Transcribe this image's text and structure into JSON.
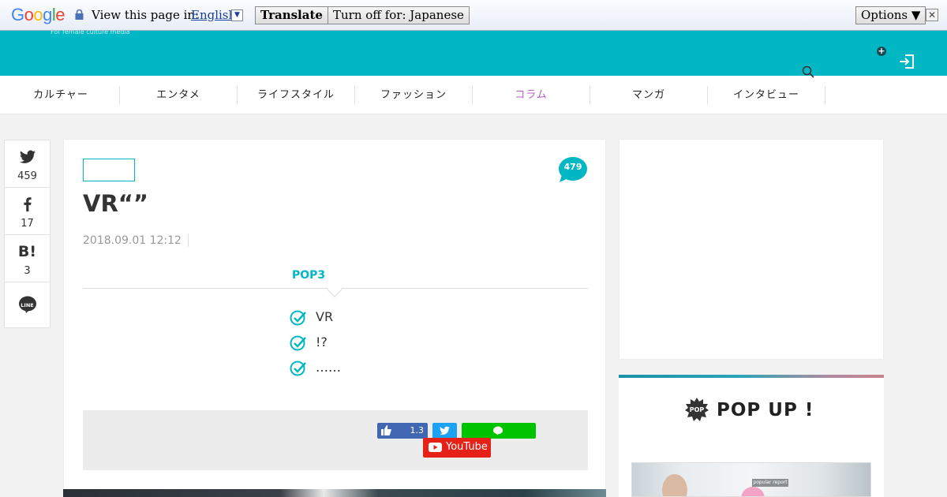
{
  "translate_bar": {
    "logo": "Google",
    "view_label": "View this page in:",
    "language": "English",
    "translate_button": "Translate",
    "turn_off_button": "Turn off for: Japanese",
    "options_button": "Options ▼",
    "close_glyph": "✕"
  },
  "header": {
    "tagline": "For female culture media"
  },
  "nav": {
    "items": [
      {
        "label": "カルチャー"
      },
      {
        "label": "エンタメ"
      },
      {
        "label": "ライフスタイル"
      },
      {
        "label": "ファッション"
      },
      {
        "label": "コラム"
      },
      {
        "label": "マンガ"
      },
      {
        "label": "インタビュー"
      }
    ],
    "active_index": 4
  },
  "share": {
    "twitter_count": "459",
    "facebook_count": "17",
    "hatena_label": "B!",
    "hatena_count": "3",
    "line_label": "LINE"
  },
  "article": {
    "comment_count": "479",
    "title": "VR“”",
    "date": "2018.09.01 12:12",
    "points_heading": "POP3",
    "points": [
      "VR",
      "!?",
      "……"
    ],
    "fb_like_count": "1.3",
    "youtube_label": "YouTube"
  },
  "sidebar": {
    "pop_badge": "POP",
    "pop_up_title": "POP UP !",
    "thumb_tag": "popular report"
  },
  "colors": {
    "accent": "#00b7c3",
    "nav_active": "#b35fbf",
    "facebook": "#4267b2",
    "twitter": "#1da1f2",
    "line": "#00c300",
    "youtube": "#e62117"
  }
}
